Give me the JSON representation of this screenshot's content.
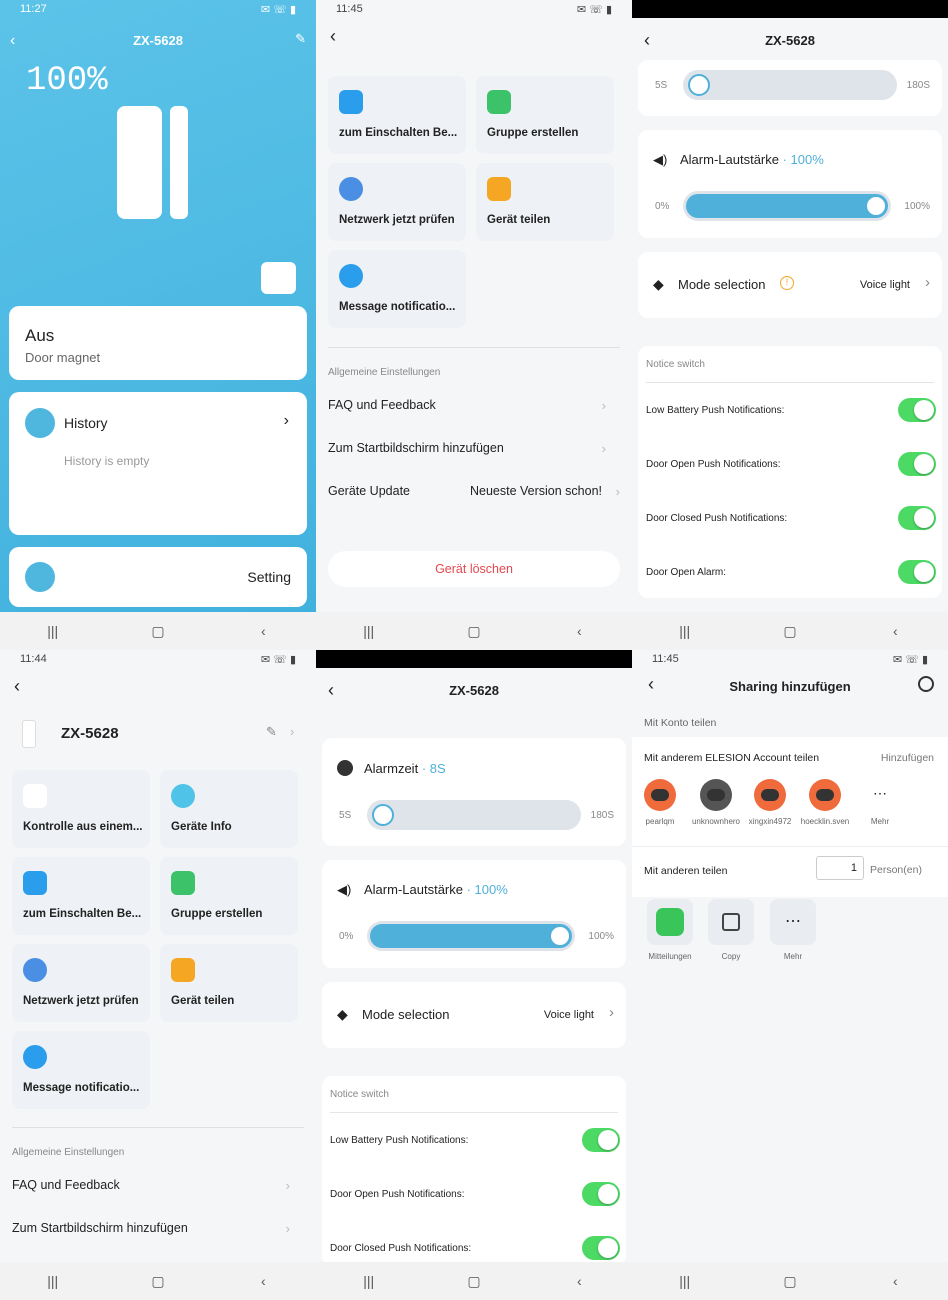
{
  "p1": {
    "time": "11:27",
    "title": "ZX-5628",
    "battery": "100%",
    "state": "Aus",
    "sub": "Door magnet",
    "history": "History",
    "history_empty": "History is empty",
    "setting": "Setting"
  },
  "p2": {
    "time": "11:45",
    "tiles": [
      "zum Einschalten Be...",
      "Gruppe erstellen",
      "Netzwerk jetzt prüfen",
      "Gerät teilen",
      "Message notificatio..."
    ],
    "section": "Allgemeine Einstellungen",
    "faq": "FAQ und Feedback",
    "home": "Zum Startbildschirm hinzufügen",
    "update": "Geräte Update",
    "update_val": "Neueste Version schon!",
    "delete": "Gerät löschen"
  },
  "p3": {
    "title": "ZX-5628",
    "min5": "5S",
    "max180": "180S",
    "vol_label": "Alarm-Lautstärke",
    "vol_val": "· 100%",
    "v0": "0%",
    "v100": "100%",
    "mode": "Mode selection",
    "mode_val": "Voice light",
    "notice": "Notice switch",
    "n1": "Low Battery Push Notifications:",
    "n2": "Door Open Push Notifications:",
    "n3": "Door Closed Push Notifications:",
    "n4": "Door Open Alarm:"
  },
  "p4": {
    "time": "11:44",
    "name": "ZX-5628",
    "tiles": [
      "Kontrolle aus einem...",
      "Geräte Info",
      "zum Einschalten Be...",
      "Gruppe erstellen",
      "Netzwerk jetzt prüfen",
      "Gerät teilen",
      "Message notificatio..."
    ],
    "section": "Allgemeine Einstellungen",
    "faq": "FAQ und Feedback",
    "home": "Zum Startbildschirm hinzufügen"
  },
  "p5": {
    "title": "ZX-5628",
    "alarm": "Alarmzeit",
    "alarm_val": "· 8S",
    "min5": "5S",
    "max180": "180S",
    "vol_label": "Alarm-Lautstärke",
    "vol_val": "· 100%",
    "v0": "0%",
    "v100": "100%",
    "mode": "Mode selection",
    "mode_val": "Voice light",
    "notice": "Notice switch",
    "n1": "Low Battery Push Notifications:",
    "n2": "Door Open Push Notifications:",
    "n3": "Door Closed Push Notifications:"
  },
  "p6": {
    "time": "11:45",
    "title": "Sharing hinzufügen",
    "konto": "Mit Konto teilen",
    "other": "Mit anderem ELESION Account teilen",
    "add": "Hinzufügen",
    "users": [
      "pearlqm",
      "unknownhero",
      "xingxin4972",
      "hoecklin.sven",
      "Mehr"
    ],
    "others": "Mit anderen teilen",
    "count": "1",
    "person": "Person(en)",
    "apps": [
      "Mitteilungen",
      "Copy",
      "Mehr"
    ]
  }
}
